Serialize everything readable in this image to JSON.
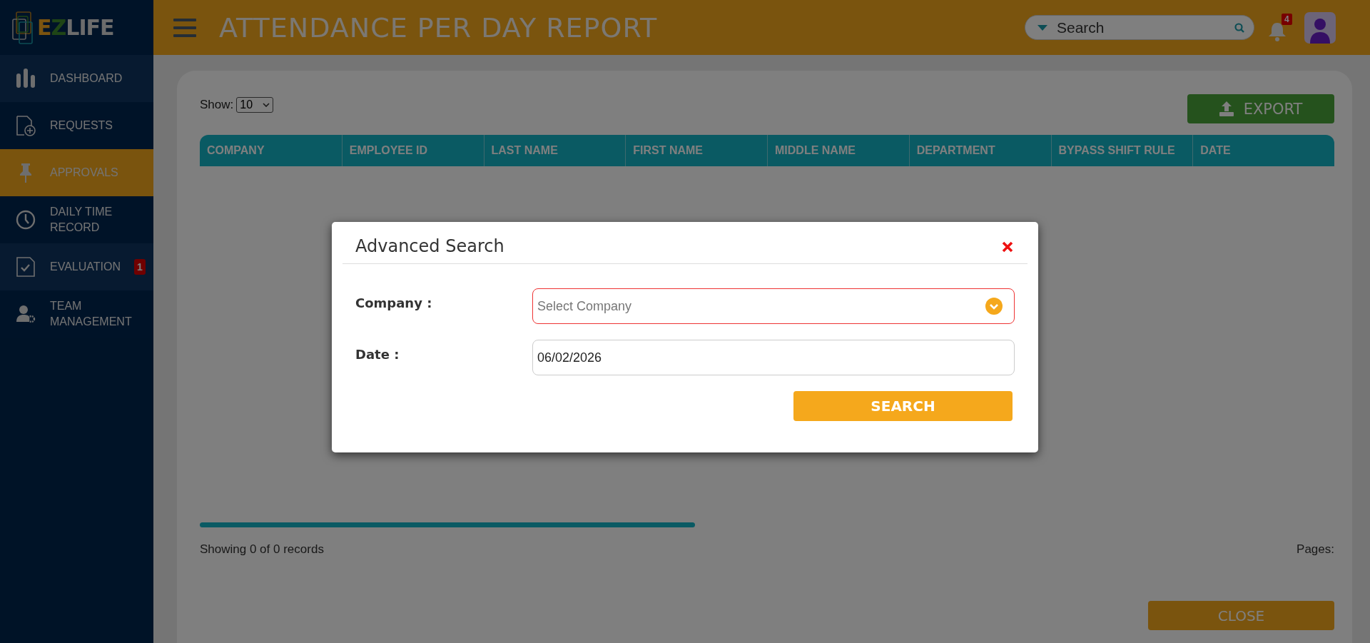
{
  "sidebar": {
    "logo": [
      "E",
      "Z",
      "LIFE"
    ],
    "items": [
      {
        "label": "DASHBOARD",
        "selected": false
      },
      {
        "label": "REQUESTS",
        "selected": false
      },
      {
        "label": "APPROVALS",
        "selected": true
      },
      {
        "label": "DAILY TIME RECORD",
        "selected": false
      },
      {
        "label": "EVALUATION",
        "selected": false,
        "badge": "1"
      },
      {
        "label": "TEAM MANAGEMENT",
        "selected": false
      }
    ]
  },
  "header": {
    "title": "ATTENDANCE PER DAY REPORT",
    "search": {
      "placeholder": "Search"
    },
    "notifications": "4"
  },
  "toolbar": {
    "show_label": "Show:",
    "page_size": "10",
    "export": "EXPORT"
  },
  "table": {
    "columns": [
      "COMPANY",
      "EMPLOYEE ID",
      "LAST NAME",
      "FIRST NAME",
      "MIDDLE NAME",
      "DEPARTMENT",
      "BYPASS SHIFT RULE",
      "DATE"
    ]
  },
  "footer": {
    "summary": "Showing 0 of  0 records",
    "pages": "Pages:",
    "close": "CLOSE"
  },
  "modal": {
    "title": "Advanced Search",
    "fields": [
      {
        "label": "Company :",
        "kind": "select",
        "placeholder": "Select Company",
        "invalid": true
      },
      {
        "label": "Date :",
        "kind": "date",
        "value": "06/02/2026",
        "invalid": false
      }
    ],
    "button": "SEARCH"
  }
}
